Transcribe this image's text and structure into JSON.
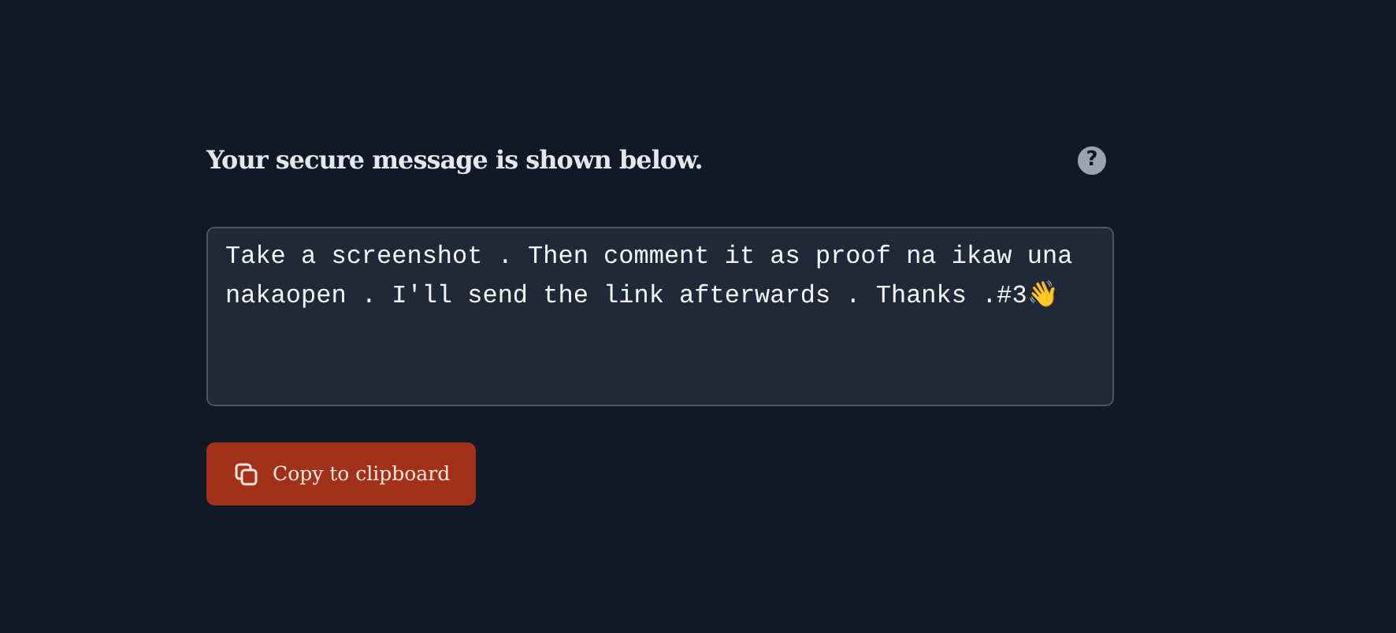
{
  "heading": "Your secure message is shown below.",
  "help_icon": "?",
  "message": "Take a screenshot . Then comment it as proof na ikaw una nakaopen . I'll send the link afterwards . Thanks .#3👋",
  "copy_button": {
    "label": "Copy to clipboard"
  }
}
